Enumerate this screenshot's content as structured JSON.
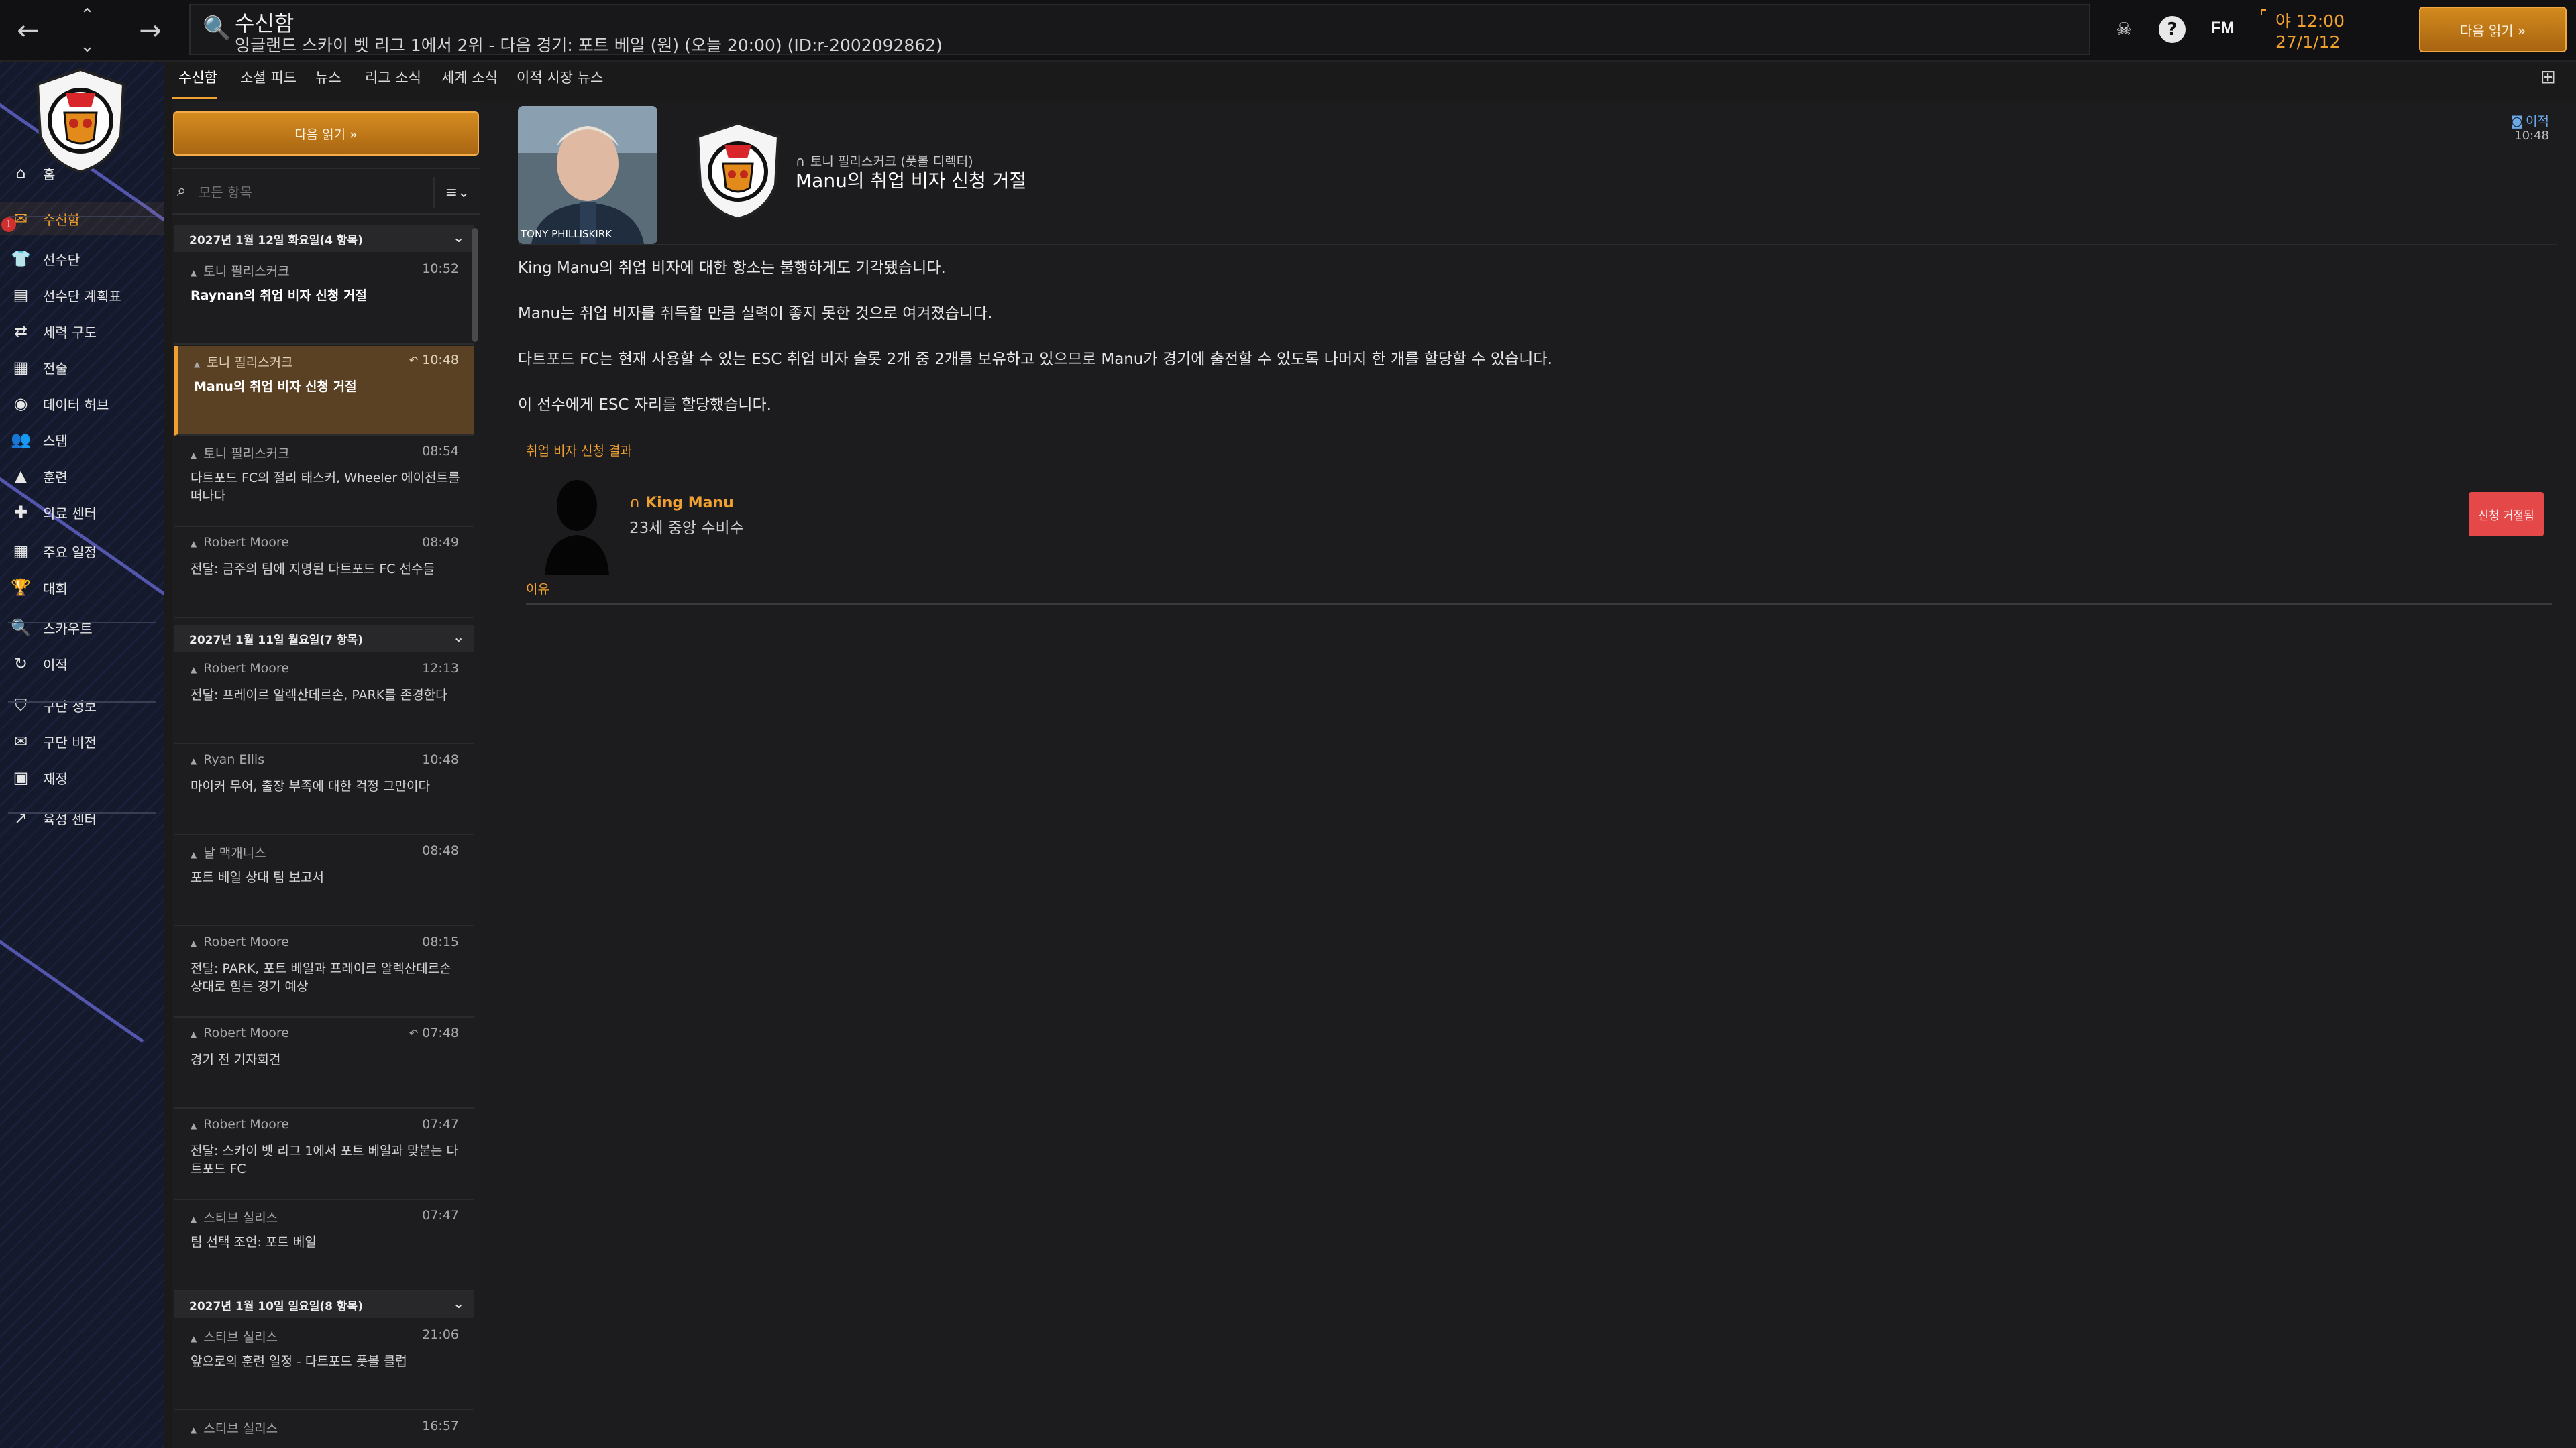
{
  "topbar": {
    "title": "수신함",
    "subtitle": "잉글랜드 스카이 벳 리그 1에서 2위 - 다음 경기: 포트 베일 (원) (오늘 20:00) (ID:r-2002092862)",
    "fm_logo": "FM",
    "time": "야 12:00",
    "date": "27/1/12",
    "continue_label": "다음 읽기 »"
  },
  "sidebar": {
    "badge": "1",
    "items": [
      {
        "label": "홈",
        "icon": "home-icon",
        "glyph": "⌂"
      },
      {
        "label": "수신함",
        "icon": "inbox-icon",
        "glyph": "✉"
      },
      {
        "label": "선수단",
        "icon": "squad-icon",
        "glyph": "👕"
      },
      {
        "label": "선수단 계획표",
        "icon": "squad-planner-icon",
        "glyph": "▤"
      },
      {
        "label": "세력 구도",
        "icon": "dynamics-icon",
        "glyph": "⇄"
      },
      {
        "label": "전술",
        "icon": "tactics-icon",
        "glyph": "▦"
      },
      {
        "label": "데이터 허브",
        "icon": "data-hub-icon",
        "glyph": "◉"
      },
      {
        "label": "스탭",
        "icon": "staff-icon",
        "glyph": "👥"
      },
      {
        "label": "훈련",
        "icon": "training-icon",
        "glyph": "▲"
      },
      {
        "label": "의료 센터",
        "icon": "medical-icon",
        "glyph": "✚"
      },
      {
        "label": "주요 일정",
        "icon": "schedule-icon",
        "glyph": "▦"
      },
      {
        "label": "대회",
        "icon": "trophy-icon",
        "glyph": "🏆"
      },
      {
        "label": "스카우트",
        "icon": "scouting-icon",
        "glyph": "🔍"
      },
      {
        "label": "이적",
        "icon": "transfers-icon",
        "glyph": "↻"
      },
      {
        "label": "구단 정보",
        "icon": "club-info-icon",
        "glyph": "⛉"
      },
      {
        "label": "구단 비전",
        "icon": "club-vision-icon",
        "glyph": "✉"
      },
      {
        "label": "재정",
        "icon": "finances-icon",
        "glyph": "▣"
      },
      {
        "label": "육성 센터",
        "icon": "development-icon",
        "glyph": "↗"
      }
    ]
  },
  "tabs": [
    "수신함",
    "소셜 피드",
    "뉴스",
    "리그 소식",
    "세계 소식",
    "이적 시장 뉴스"
  ],
  "list": {
    "continue_label": "다음 읽기 »",
    "filter_placeholder": "모든 항목",
    "groups": [
      {
        "header": "2027년 1월 12일 화요일(4 항목)"
      },
      {
        "header": "2027년 1월 11일 월요일(7 항목)"
      },
      {
        "header": "2027년 1월 10일 일요일(8 항목)"
      }
    ],
    "messages": [
      {
        "sender": "토니 필리스커크",
        "time": "10:52",
        "subject": "Raynan의 취업 비자 신청 거절"
      },
      {
        "sender": "토니 필리스커크",
        "time": "10:48",
        "subject": "Manu의 취업 비자 신청 거절"
      },
      {
        "sender": "토니 필리스커크",
        "time": "08:54",
        "subject": "다트포드 FC의 절리 태스커, Wheeler 에이전트를 떠나다"
      },
      {
        "sender": "Robert Moore",
        "time": "08:49",
        "subject": "전달: 금주의 팀에 지명된 다트포드 FC 선수들"
      },
      {
        "sender": "Robert Moore",
        "time": "12:13",
        "subject": "전달: 프레이르 알렉산데르손, PARK를 존경한다"
      },
      {
        "sender": "Ryan Ellis",
        "time": "10:48",
        "subject": "마이커 무어, 출장 부족에 대한 걱정 그만이다"
      },
      {
        "sender": "날 맥개니스",
        "time": "08:48",
        "subject": "포트 베일 상대 팀 보고서"
      },
      {
        "sender": "Robert Moore",
        "time": "08:15",
        "subject": "전달: PARK, 포트 베일과 프레이르 알렉산데르손 상대로 힘든 경기 예상"
      },
      {
        "sender": "Robert Moore",
        "time": "07:48",
        "subject": "경기 전 기자회견"
      },
      {
        "sender": "Robert Moore",
        "time": "07:47",
        "subject": "전달: 스카이 벳 리그 1에서 포트 베일과 맞붙는 다트포드 FC"
      },
      {
        "sender": "스티브 실리스",
        "time": "07:47",
        "subject": "팀 선택 조언: 포트 베일"
      },
      {
        "sender": "스티브 실리스",
        "time": "21:06",
        "subject": "앞으로의 훈련 일정 - 다트포드 풋볼 클럽"
      },
      {
        "sender": "스티브 실리스",
        "time": "16:57",
        "subject": ""
      }
    ]
  },
  "message": {
    "photo_caption": "TONY PHILLISKIRK",
    "sender": "토니 필리스커크 (풋볼 디렉터)",
    "subject": "Manu의 취업 비자 신청 거절",
    "email_badge": "이적",
    "email_time": "10:48",
    "paragraphs": [
      "King Manu의 취업 비자에 대한 항소는 불행하게도 기각됐습니다.",
      "Manu는 취업 비자를 취득할 만큼 실력이 좋지 못한 것으로 여겨졌습니다.",
      "다트포드 FC는 현재 사용할 수 있는 ESC 취업 비자 슬롯 2개 중 2개를 보유하고 있으므로 Manu가 경기에 출전할 수 있도록 나머지 한 개를 할당할 수 있습니다.",
      "이 선수에게 ESC 자리를 할당했습니다."
    ],
    "section_label": "취업 비자 신청 결과",
    "player_name": "King Manu",
    "player_desc": "23세 중앙 수비수",
    "status_button": "신청 거절됨",
    "reason_label": "이유"
  },
  "colors": {
    "accent": "#f0a030",
    "selected_row": "#5a4124",
    "reject": "#e44848",
    "sidebar_bg": "#141a2c"
  }
}
